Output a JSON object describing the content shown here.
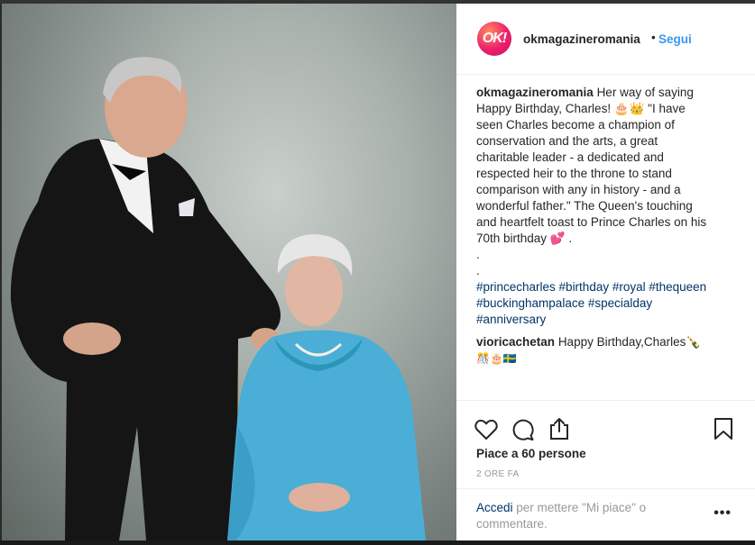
{
  "post": {
    "account": {
      "username": "okmagazineromania",
      "avatar_text": "OK!",
      "follow_label": "Segui",
      "separator": "•"
    },
    "caption": {
      "username": "okmagazineromania",
      "lines": [
        "Her way of saying",
        "Happy Birthday, Charles! 🎂👑 \"I have",
        "seen Charles become a champion of",
        "conservation and the arts, a great",
        "charitable leader - a dedicated and",
        "respected heir to the throne to stand",
        "comparison with any in history - and a",
        "wonderful father.\" The Queen's touching",
        "and heartfelt toast to Prince Charles on his",
        "70th birthday 💕 ."
      ],
      "dots": [
        ".",
        "."
      ],
      "hashtag_lines": [
        "#princecharles #birthday #royal #thequeen",
        "#buckinghampalace #specialday",
        "#anniversary"
      ]
    },
    "comment": {
      "username": "viorica​chetan",
      "text": "Happy Birthday,Charles🍾",
      "emoji_line": "🎊🎂🇸🇪"
    },
    "actions": {
      "like_icon": "heart-icon",
      "comment_icon": "comment-icon",
      "share_icon": "share-icon",
      "save_icon": "bookmark-icon"
    },
    "likes_text": "Piace a 60 persone",
    "time_ago": "2 ORE FA",
    "login": {
      "link": "Accedi",
      "text": " per mettere \"Mi piace\" o commentare."
    },
    "more_label": "•••",
    "colors": {
      "link_blue": "#3897f0",
      "hashtag": "#003569",
      "muted": "#999999"
    }
  }
}
